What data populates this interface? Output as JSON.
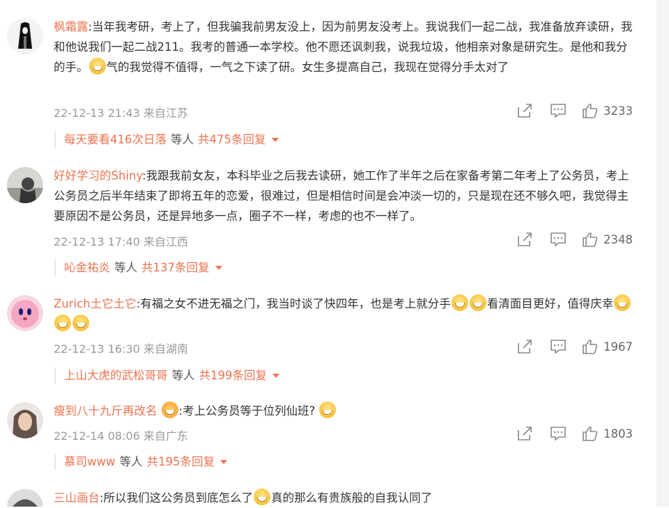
{
  "comments": [
    {
      "user": "枫霜露",
      "text": ":当年我考研，考上了，但我骗我前男友没上，因为前男友没考上。我说我们一起二战，我准备放弃读研，我和他说我们一起二战211。我考的普通一本学校。他不愿还讽刺我，说我垃圾，他相亲对象是研究生。是他和我分的手。",
      "text_after": "气的我觉得不值得，一气之下读了研。女生多提高自己，我现在觉得分手太对了",
      "meta": "22-12-13 21:43 来自江苏",
      "likes": "3233",
      "reply_who": "每天要看416次日落",
      "reply_mid": "等人",
      "reply_count": "共475条回复"
    },
    {
      "user": "好好学习的Shiny",
      "text": ":我跟我前女友，本科毕业之后我去读研，她工作了半年之后在家备考第二年考上了公务员，考上公务员之后半年结束了即将五年的恋爱，很难过，但是相信时间是会冲淡一切的，只是现在还不够久吧，我觉得主要原因不是公务员，还是异地多一点，圈子不一样，考虑的也不一样了。",
      "meta": "22-12-13 17:40 来自江西",
      "likes": "2348",
      "reply_who": "吣金祐炎",
      "reply_mid": "等人",
      "reply_count": "共137条回复"
    },
    {
      "user": "Zurich土它土它",
      "text": ":有福之女不进无福之门，我当时谈了快四年，也是考上就分手",
      "text_after": "看清面目更好，值得庆幸",
      "meta": "22-12-13 16:30 来自湖南",
      "likes": "1967",
      "reply_who": "上山大虎的武松哥哥",
      "reply_mid": "等人",
      "reply_count": "共199条回复"
    },
    {
      "user": "瘦到八十九斤再改名",
      "text": ":考上公务员等于位列仙班?",
      "meta": "22-12-14 08:06 来自广东",
      "likes": "1803",
      "reply_who": "慕司www",
      "reply_mid": "等人",
      "reply_count": "共195条回复"
    },
    {
      "user": "三山画台",
      "text": ":所以我们这公务员到底怎么了",
      "text_after": "真的那么有贵族般的自我认同了"
    }
  ],
  "icons": [
    "share-icon",
    "comment-icon",
    "like-icon",
    "dropdown-caret-icon",
    "emoji-icon"
  ],
  "colors": {
    "username": "#eb7350",
    "meta": "#999999",
    "text": "#333333"
  }
}
